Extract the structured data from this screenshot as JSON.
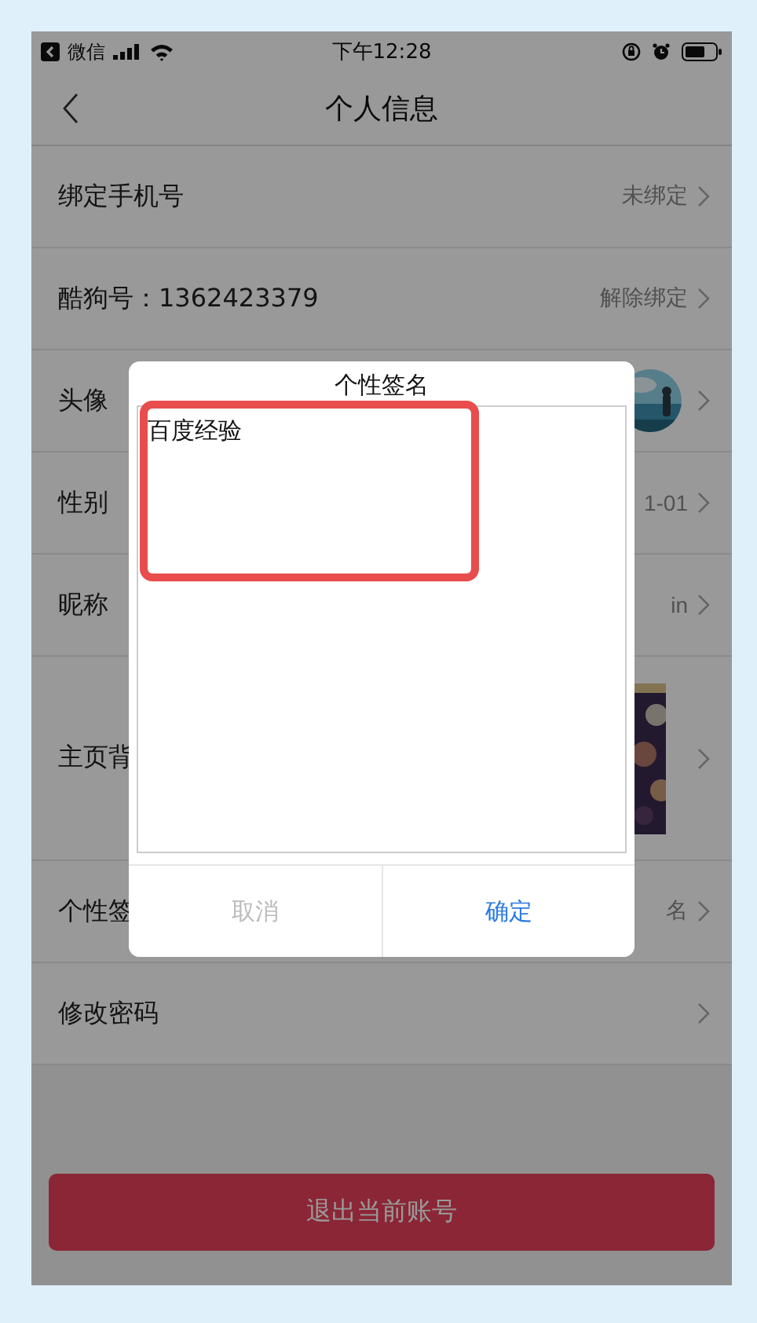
{
  "status_bar": {
    "back_app": "微信",
    "time": "下午12:28"
  },
  "nav": {
    "title": "个人信息"
  },
  "rows": [
    {
      "kind": "text",
      "label": "绑定手机号",
      "value": "未绑定"
    },
    {
      "kind": "text",
      "label": "酷狗号：1362423379",
      "value": "解除绑定"
    },
    {
      "kind": "avatar",
      "label": "头像"
    },
    {
      "kind": "text",
      "label": "性别",
      "value": "1-01"
    },
    {
      "kind": "text",
      "label": "昵称",
      "value": "in"
    },
    {
      "kind": "cover",
      "label": "主页背"
    },
    {
      "kind": "text",
      "label": "个性签",
      "value": "名"
    },
    {
      "kind": "text",
      "label": "修改密码"
    }
  ],
  "logout_button": "退出当前账号",
  "dialog": {
    "title": "个性签名",
    "value": "百度经验",
    "buttons": [
      {
        "label": "取消",
        "kind": "cancel"
      },
      {
        "label": "确定",
        "kind": "confirm"
      }
    ]
  }
}
